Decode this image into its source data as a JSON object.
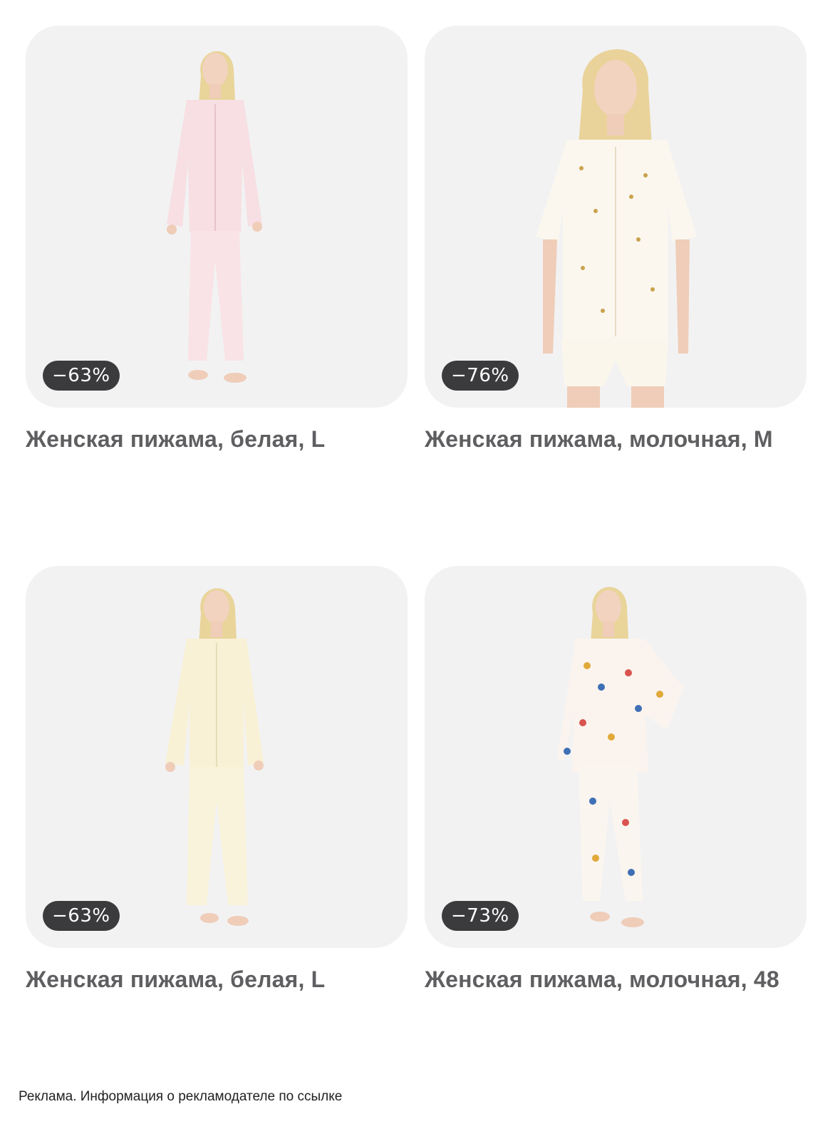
{
  "products": [
    {
      "title": "Женская пижама, белая, L",
      "discount": "−63%",
      "image": "model-long-sleeve-pink-pajama"
    },
    {
      "title": "Женская пижама, молочная, M",
      "discount": "−76%",
      "image": "model-short-sleeve-milk-pajama"
    },
    {
      "title": "Женская пижама, белая, L",
      "discount": "−63%",
      "image": "model-long-sleeve-cream-pajama"
    },
    {
      "title": "Женская пижама, молочная, 48",
      "discount": "−73%",
      "image": "model-long-sleeve-printed-pajama"
    }
  ],
  "footer": {
    "ad_disclaimer": "Реклама. Информация о рекламодателе по ссылке"
  },
  "colors": {
    "card_background": "#f2f2f3",
    "badge_background": "#3b3b3d",
    "title_text": "#5f5f62"
  }
}
